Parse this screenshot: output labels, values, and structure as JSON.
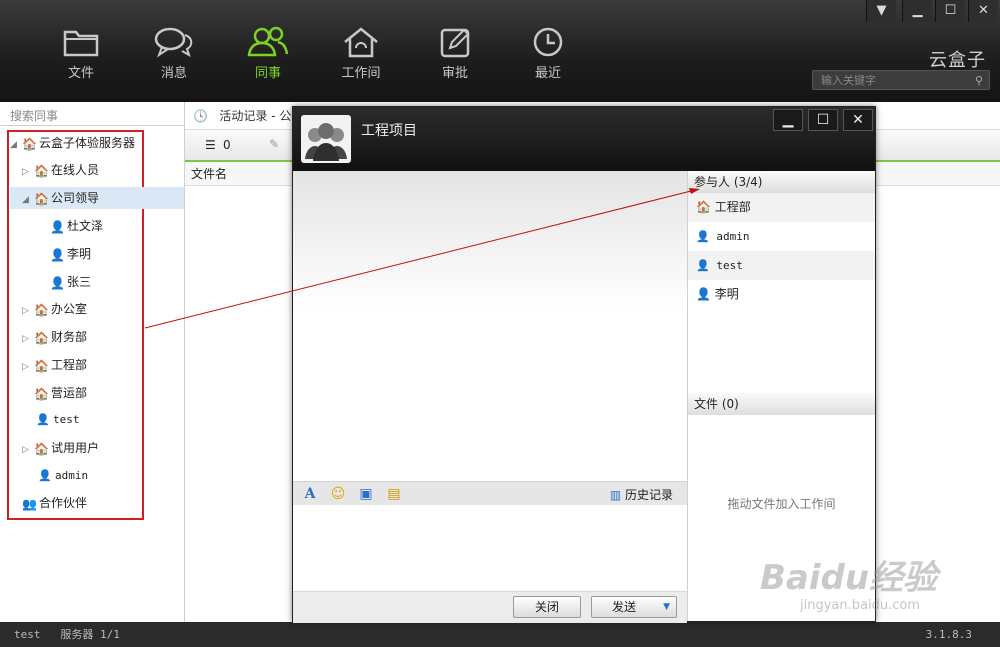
{
  "nav": [
    {
      "label": "文件",
      "icon": "folder-icon"
    },
    {
      "label": "消息",
      "icon": "chat-icon"
    },
    {
      "label": "同事",
      "icon": "people-icon",
      "active": true
    },
    {
      "label": "工作间",
      "icon": "home-icon"
    },
    {
      "label": "审批",
      "icon": "edit-icon"
    },
    {
      "label": "最近",
      "icon": "clock-icon"
    }
  ],
  "brand": "云盒子",
  "search_top": {
    "placeholder": "输入关键字"
  },
  "sidebar": {
    "search_placeholder": "搜索同事",
    "tree": [
      {
        "label": "云盒子体验服务器"
      },
      {
        "label": "在线人员"
      },
      {
        "label": "公司领导"
      },
      {
        "label": "杜文泽"
      },
      {
        "label": "李明"
      },
      {
        "label": "张三"
      },
      {
        "label": "办公室"
      },
      {
        "label": "财务部"
      },
      {
        "label": "工程部"
      },
      {
        "label": "营运部"
      },
      {
        "label": "test"
      },
      {
        "label": "试用用户"
      },
      {
        "label": "admin"
      },
      {
        "label": "合作伙伴"
      }
    ]
  },
  "content": {
    "tab": "活动记录 - 公",
    "count": "0",
    "col_file": "文件名"
  },
  "dialog": {
    "title": "工程项目",
    "participants_header": "参与人 (3/4)",
    "members": [
      "工程部",
      "admin",
      "test",
      "李明"
    ],
    "files_header": "文件 (0)",
    "drop_hint": "拖动文件加入工作间",
    "history": "历史记录",
    "close": "关闭",
    "send": "发送"
  },
  "status": {
    "user": "test",
    "server": "服务器 1/1",
    "version": "3.1.8.3"
  },
  "watermark": {
    "logo": "Baidu经验",
    "url": "jingyan.baidu.com"
  },
  "colors": {
    "accent": "#7ed321",
    "highlight": "#d02020"
  }
}
